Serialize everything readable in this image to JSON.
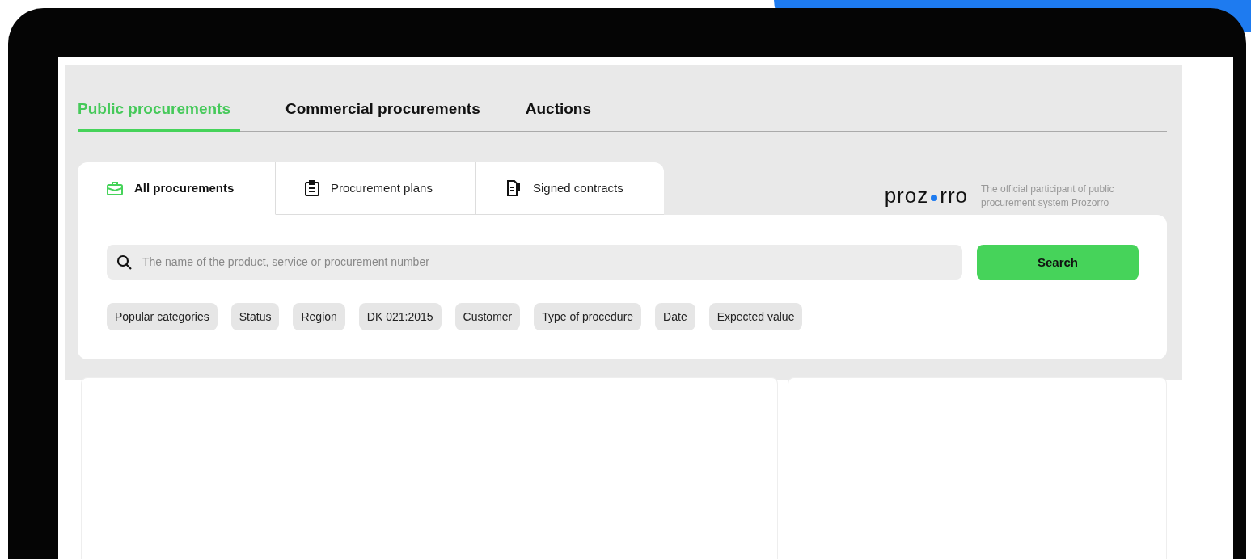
{
  "top_tabs": [
    {
      "label": "Public procurements",
      "selected": true
    },
    {
      "label": "Commercial procurements",
      "selected": false
    },
    {
      "label": "Auctions",
      "selected": false
    }
  ],
  "sub_tabs": [
    {
      "label": "All procurements",
      "selected": true
    },
    {
      "label": "Procurement plans",
      "selected": false
    },
    {
      "label": "Signed contracts",
      "selected": false
    }
  ],
  "logo": {
    "before_dot": "proz",
    "after_dot": "rro",
    "tagline": "The official participant of public procurement system Prozorro"
  },
  "search": {
    "placeholder": "The name of the product, service or procurement number",
    "button": "Search"
  },
  "filters": [
    "Popular categories",
    "Status",
    "Region",
    "DK 021:2015",
    "Customer",
    "Type of procedure",
    "Date",
    "Expected value"
  ]
}
